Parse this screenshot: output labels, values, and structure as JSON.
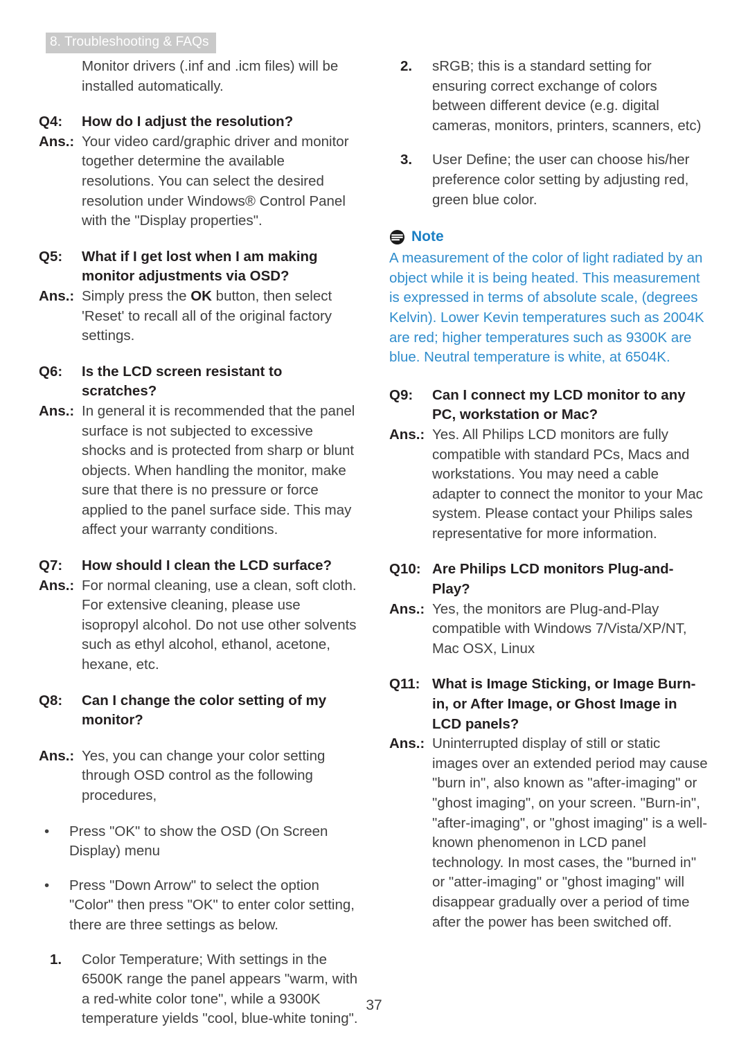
{
  "header": {
    "chapter_label": "8. Troubleshooting & FAQs"
  },
  "footer": {
    "page_number": "37"
  },
  "colors": {
    "header_background": "#c9c9c9",
    "header_text": "#ffffff",
    "note_title": "#1b7fc4",
    "note_body": "#2e8ccc",
    "body_text": "#404040",
    "heading_text": "#231f20"
  },
  "left_column": {
    "intro_paragraph": "Monitor drivers (.inf and .icm files) will be installed automatically.",
    "faqs": [
      {
        "q_label": "Q4:",
        "question": "How do I adjust the resolution?",
        "a_label": "Ans.:",
        "answer": "Your video card/graphic driver and monitor together determine the available resolutions. You can select the desired resolution under Windows® Control Panel with the \"Display properties\"."
      },
      {
        "q_label": "Q5:",
        "question": "What if I get lost when I am making monitor adjustments via OSD?",
        "a_label": "Ans.:",
        "answer_prefix": "Simply press the ",
        "answer_bold": "OK",
        "answer_suffix": " button, then select 'Reset' to recall all of the original factory settings."
      },
      {
        "q_label": "Q6:",
        "question": "Is the LCD screen resistant to scratches?",
        "a_label": "Ans.:",
        "answer": "In general it is recommended that the panel surface is not subjected to excessive shocks and is protected from sharp or blunt objects. When handling the monitor, make sure that there is no pressure or force applied to the panel surface side. This may affect your warranty conditions."
      },
      {
        "q_label": "Q7:",
        "question": "How should I clean the LCD surface?",
        "a_label": "Ans.:",
        "answer": "For normal cleaning, use a clean, soft cloth. For extensive cleaning, please use isopropyl alcohol. Do not use other solvents such as ethyl alcohol, ethanol, acetone, hexane, etc."
      },
      {
        "q_label": "Q8:",
        "question": "Can I change the color setting of my monitor?",
        "a_label": "Ans.:",
        "answer": "Yes, you can change your color setting through OSD control as the following procedures,"
      }
    ],
    "bullets": [
      {
        "mark": "•",
        "text": "Press \"OK\" to show the OSD (On Screen Display) menu"
      },
      {
        "mark": "•",
        "text": "Press \"Down Arrow\" to select the option \"Color\" then press \"OK\" to enter color setting, there are three settings as below."
      }
    ],
    "numbered": [
      {
        "mark": "1.",
        "text": "Color Temperature; With settings in the 6500K range the panel appears \"warm, with a red-white color tone\", while a 9300K temperature yields \"cool, blue-white toning\"."
      }
    ]
  },
  "right_column": {
    "numbered": [
      {
        "mark": "2.",
        "text": "sRGB; this is a standard setting for ensuring correct exchange of colors between different device (e.g. digital cameras, monitors, printers, scanners, etc)"
      },
      {
        "mark": "3.",
        "text": "User Define; the user can choose his/her preference color setting by adjusting red, green blue color."
      }
    ],
    "note": {
      "icon": "note-bullet-circle-icon",
      "title": "Note",
      "body": "A measurement of the color of light radiated by an object while it is being heated. This measurement is expressed in terms of absolute scale, (degrees Kelvin). Lower Kevin temperatures such as 2004K are red; higher temperatures such as 9300K are blue. Neutral temperature is white, at 6504K."
    },
    "faqs": [
      {
        "q_label": "Q9:",
        "question": "Can I connect my LCD monitor to any PC, workstation or Mac?",
        "a_label": "Ans.:",
        "answer": "Yes. All Philips LCD monitors are fully compatible with standard PCs, Macs and workstations. You may need a cable adapter to connect the monitor to your Mac system. Please contact your Philips sales representative for more information."
      },
      {
        "q_label": "Q10:",
        "question": "Are Philips LCD monitors Plug-and-Play?",
        "a_label": "Ans.:",
        "answer": "Yes, the monitors are Plug-and-Play compatible with Windows 7/Vista/XP/NT, Mac OSX, Linux"
      },
      {
        "q_label": "Q11:",
        "question": "What is Image Sticking, or Image Burn-in, or After Image, or Ghost Image in LCD panels?",
        "a_label": "Ans.:",
        "answer": "Uninterrupted display of still or static images over an extended period may cause \"burn in\", also known as \"after-imaging\" or \"ghost imaging\", on your screen. \"Burn-in\", \"after-imaging\", or \"ghost imaging\" is a well-known phenomenon in LCD panel technology. In most cases, the \"burned in\" or \"atter-imaging\" or \"ghost imaging\" will disappear gradually over a period of time after the power has been switched off."
      }
    ]
  }
}
